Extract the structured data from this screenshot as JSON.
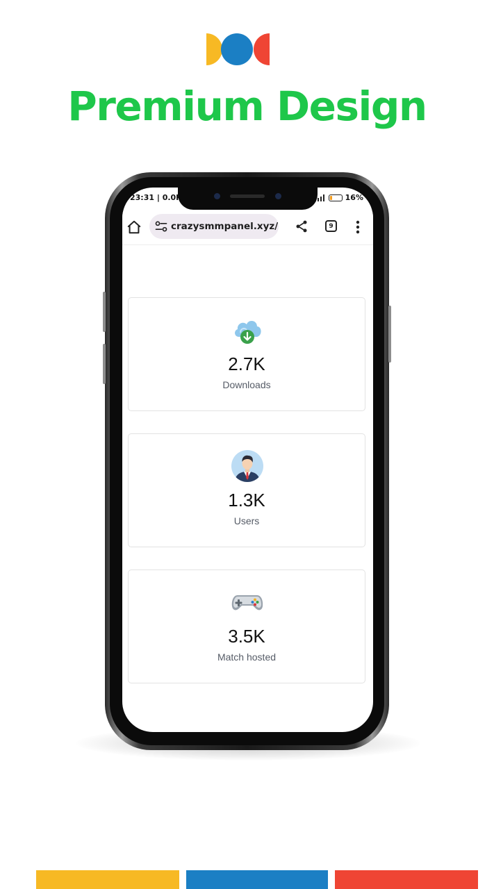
{
  "headline": "Premium Design",
  "colors": {
    "headline": "#1ec74a",
    "yellow": "#f7b924",
    "blue": "#1b7fc4",
    "red": "#ef4534",
    "download_green": "#3aa14b",
    "cloud_blue": "#8ec7ec",
    "avatar_bg": "#bcdcf4"
  },
  "status_bar": {
    "time": "23:31 | 0.0K",
    "battery": "16%",
    "battery_level": 0.16
  },
  "browser": {
    "url": "crazysmmpanel.xyz/",
    "tab_count": "9"
  },
  "stats": [
    {
      "icon": "cloud-download-icon",
      "value": "2.7K",
      "label": "Downloads"
    },
    {
      "icon": "user-avatar-icon",
      "value": "1.3K",
      "label": "Users"
    },
    {
      "icon": "gamepad-icon",
      "value": "3.5K",
      "label": "Match hosted"
    }
  ]
}
